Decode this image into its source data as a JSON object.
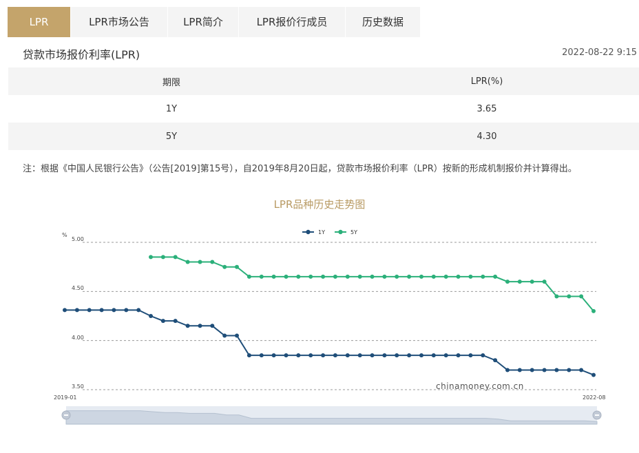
{
  "tabs": [
    {
      "label": "LPR",
      "active": true
    },
    {
      "label": "LPR市场公告",
      "active": false
    },
    {
      "label": "LPR简介",
      "active": false
    },
    {
      "label": "LPR报价行成员",
      "active": false
    },
    {
      "label": "历史数据",
      "active": false
    }
  ],
  "section": {
    "title": "贷款市场报价利率(LPR)",
    "timestamp": "2022-08-22 9:15"
  },
  "table": {
    "headers": [
      "期限",
      "LPR(%)"
    ],
    "rows": [
      [
        "1Y",
        "3.65"
      ],
      [
        "5Y",
        "4.30"
      ]
    ]
  },
  "note": "注：根据《中国人民银行公告》（公告[2019]第15号），自2019年8月20日起，贷款市场报价利率（LPR）按新的形成机制报价并计算得出。",
  "chart_data": {
    "type": "line",
    "title": "LPR品种历史走势图",
    "ylabel": "%",
    "ylim": [
      3.5,
      5.0
    ],
    "yticks": [
      "5.00",
      "4.50",
      "4.00",
      "3.50"
    ],
    "x_start_label": "2019-01",
    "x_end_label": "2022-08",
    "legend_position": "top-center",
    "grid": true,
    "watermark": "chinamoney.com.cn",
    "x": [
      "2019-01",
      "2019-02",
      "2019-03",
      "2019-04",
      "2019-05",
      "2019-06",
      "2019-07",
      "2019-08",
      "2019-09",
      "2019-10",
      "2019-11",
      "2019-12",
      "2020-01",
      "2020-02",
      "2020-03",
      "2020-04",
      "2020-05",
      "2020-06",
      "2020-07",
      "2020-08",
      "2020-09",
      "2020-10",
      "2020-11",
      "2020-12",
      "2021-01",
      "2021-02",
      "2021-03",
      "2021-04",
      "2021-05",
      "2021-06",
      "2021-07",
      "2021-08",
      "2021-09",
      "2021-10",
      "2021-11",
      "2021-12",
      "2022-01",
      "2022-02",
      "2022-03",
      "2022-04",
      "2022-05",
      "2022-06",
      "2022-07",
      "2022-08"
    ],
    "series": [
      {
        "name": "1Y",
        "color": "#1f4e79",
        "values": [
          4.31,
          4.31,
          4.31,
          4.31,
          4.31,
          4.31,
          4.31,
          4.25,
          4.2,
          4.2,
          4.15,
          4.15,
          4.15,
          4.05,
          4.05,
          3.85,
          3.85,
          3.85,
          3.85,
          3.85,
          3.85,
          3.85,
          3.85,
          3.85,
          3.85,
          3.85,
          3.85,
          3.85,
          3.85,
          3.85,
          3.85,
          3.85,
          3.85,
          3.85,
          3.85,
          3.8,
          3.7,
          3.7,
          3.7,
          3.7,
          3.7,
          3.7,
          3.7,
          3.65
        ]
      },
      {
        "name": "5Y",
        "color": "#2bb07a",
        "values": [
          null,
          null,
          null,
          null,
          null,
          null,
          null,
          4.85,
          4.85,
          4.85,
          4.8,
          4.8,
          4.8,
          4.75,
          4.75,
          4.65,
          4.65,
          4.65,
          4.65,
          4.65,
          4.65,
          4.65,
          4.65,
          4.65,
          4.65,
          4.65,
          4.65,
          4.65,
          4.65,
          4.65,
          4.65,
          4.65,
          4.65,
          4.65,
          4.65,
          4.65,
          4.6,
          4.6,
          4.6,
          4.6,
          4.45,
          4.45,
          4.45,
          4.3
        ]
      }
    ]
  }
}
